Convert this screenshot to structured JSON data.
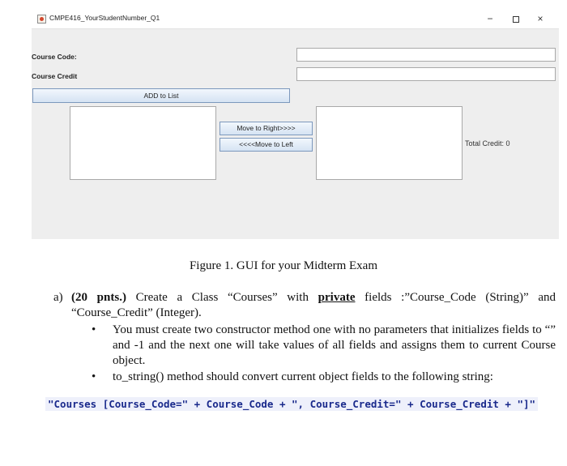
{
  "window": {
    "title": "CMPE416_YourStudentNumber_Q1",
    "controls": {
      "minimize": "−",
      "maximize": "□",
      "close": "×"
    }
  },
  "form": {
    "course_code_label": "Course Code:",
    "course_code_value": "",
    "course_credit_label": "Course Credit",
    "course_credit_value": "",
    "add_button": "ADD to List",
    "move_right_button": "Move to Right>>>>",
    "move_left_button": "<<<<Move to Left",
    "total_credit": "Total Credit: 0"
  },
  "document": {
    "caption": "Figure 1. GUI for your Midterm Exam",
    "item_a": {
      "marker": "a)",
      "points": "(20 pnts.)",
      "text_1": " Create a Class “Courses” with ",
      "private_word": "private",
      "text_2": " fields :”Course_Code (String)” and “Course_Credit” (Integer)."
    },
    "bullets": [
      "You must create two constructor method one with no parameters that initializes fields to “” and -1 and the next one will take values of all fields and assigns them to current Course object.",
      "to_string() method should convert current object fields to the following string:"
    ],
    "code_line": "\"Courses [Course_Code=\" + Course_Code + \", Course_Credit=\" + Course_Credit + \"]\""
  }
}
